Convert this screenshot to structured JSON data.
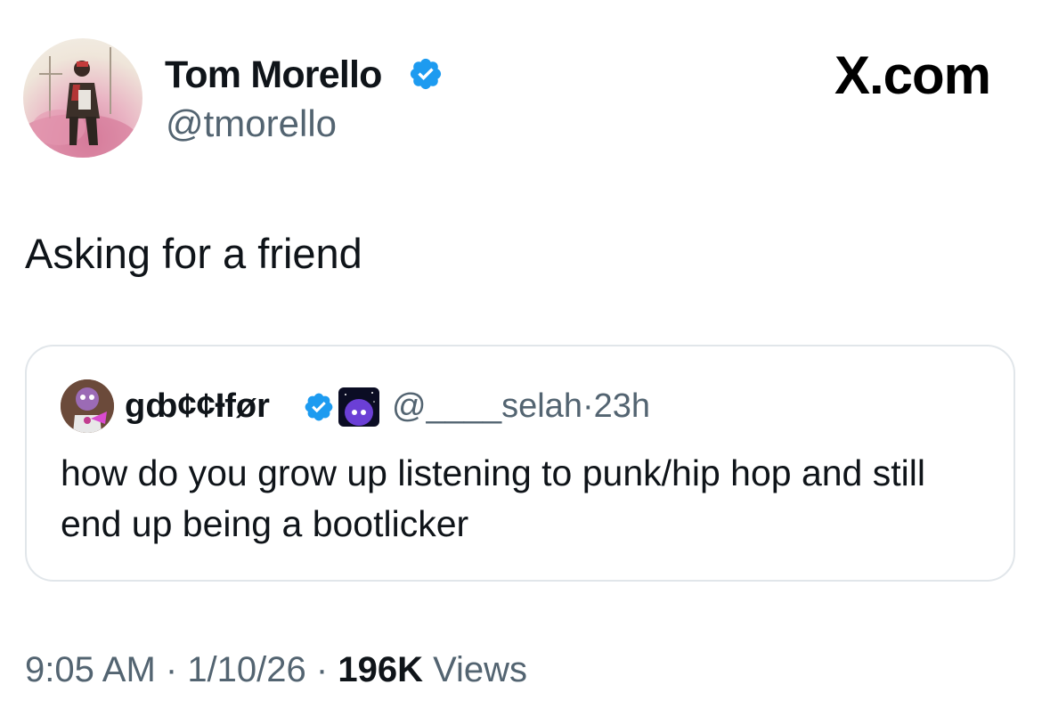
{
  "author": {
    "name": "Tom Morello",
    "handle": "@tmorello",
    "verified": true
  },
  "brand": "X.com",
  "tweet": {
    "text": "Asking for a friend"
  },
  "quoted_tweet": {
    "author_name": "gȸ¢¢Ɨfør",
    "verified": true,
    "handle": "@____selah",
    "separator": "·",
    "age": "23h",
    "text": "how do you grow up listening to punk/hip hop and still end up being a bootlicker"
  },
  "meta": {
    "time": "9:05 AM",
    "separator1": " · ",
    "date": "1/10/26",
    "separator2": " · ",
    "views_count": "196K",
    "views_label": " Views"
  },
  "colors": {
    "verified_blue": "#1d9bf0",
    "secondary_text": "#536471",
    "primary_text": "#0f1419",
    "border": "#e1e6ea"
  },
  "icons": {
    "verified": "verified-badge-icon",
    "brand": "x-logo"
  }
}
